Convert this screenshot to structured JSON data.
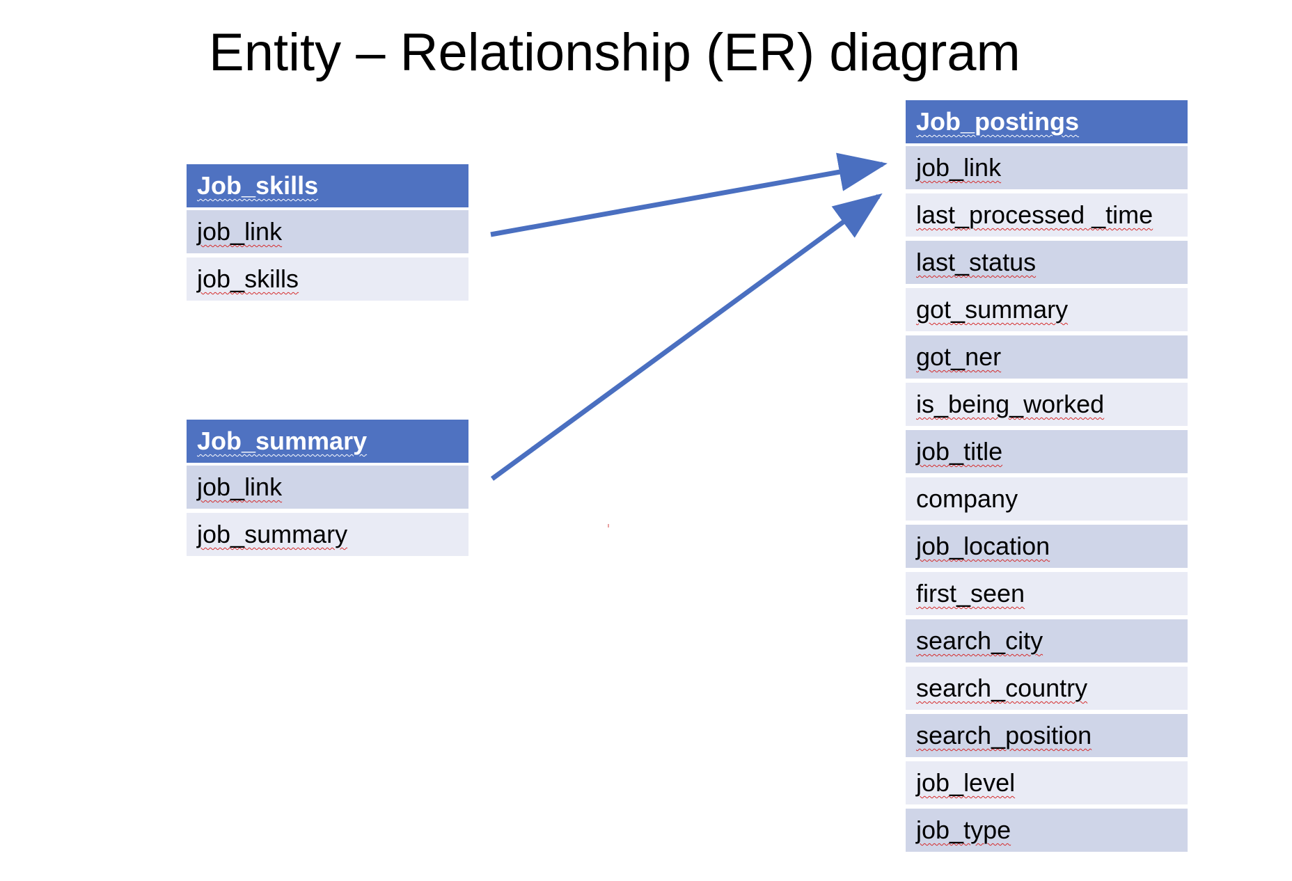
{
  "title": "Entity – Relationship (ER) diagram",
  "entities": [
    {
      "name": "Job_skills",
      "fields": [
        "job_link",
        "job_skills"
      ]
    },
    {
      "name": "Job_summary",
      "fields": [
        "job_link",
        "job_summary"
      ]
    },
    {
      "name": "Job_postings",
      "fields": [
        "job_link",
        "last_processed _time",
        "last_status",
        "got_summary",
        "got_ner",
        "is_being_worked",
        "job_title",
        "company",
        "job_location",
        "first_seen",
        "search_city",
        "search_country",
        "search_position",
        "job_level",
        "job_type"
      ]
    }
  ],
  "relationships": [
    {
      "from": "Job_skills",
      "to": "Job_postings"
    },
    {
      "from": "Job_summary",
      "to": "Job_postings"
    }
  ],
  "colors": {
    "header": "#4f72c1",
    "row_dark": "#cfd5e8",
    "row_light": "#e9ebf5",
    "arrow": "#4a6fc0",
    "spellcheck": "#d42a2a"
  }
}
